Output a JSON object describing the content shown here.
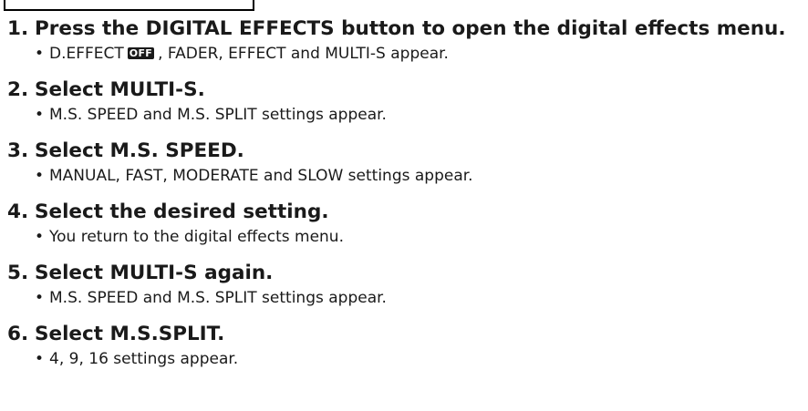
{
  "steps": [
    {
      "number": "1.",
      "title": "Press the DIGITAL EFFECTS button to open the digital effects menu.",
      "note_before": "D.EFFECT",
      "badge": "OFF",
      "note_after": ", FADER, EFFECT and MULTI-S appear."
    },
    {
      "number": "2.",
      "title": "Select MULTI-S.",
      "note": "M.S. SPEED and M.S. SPLIT settings appear."
    },
    {
      "number": "3.",
      "title": "Select M.S. SPEED.",
      "note": "MANUAL, FAST, MODERATE and SLOW settings appear."
    },
    {
      "number": "4.",
      "title": "Select the desired setting.",
      "note": "You return to the digital effects menu."
    },
    {
      "number": "5.",
      "title": "Select MULTI-S again.",
      "note": "M.S. SPEED and M.S. SPLIT settings appear."
    },
    {
      "number": "6.",
      "title": "Select M.S.SPLIT.",
      "note": "4, 9, 16 settings appear."
    }
  ],
  "bullet": "•"
}
